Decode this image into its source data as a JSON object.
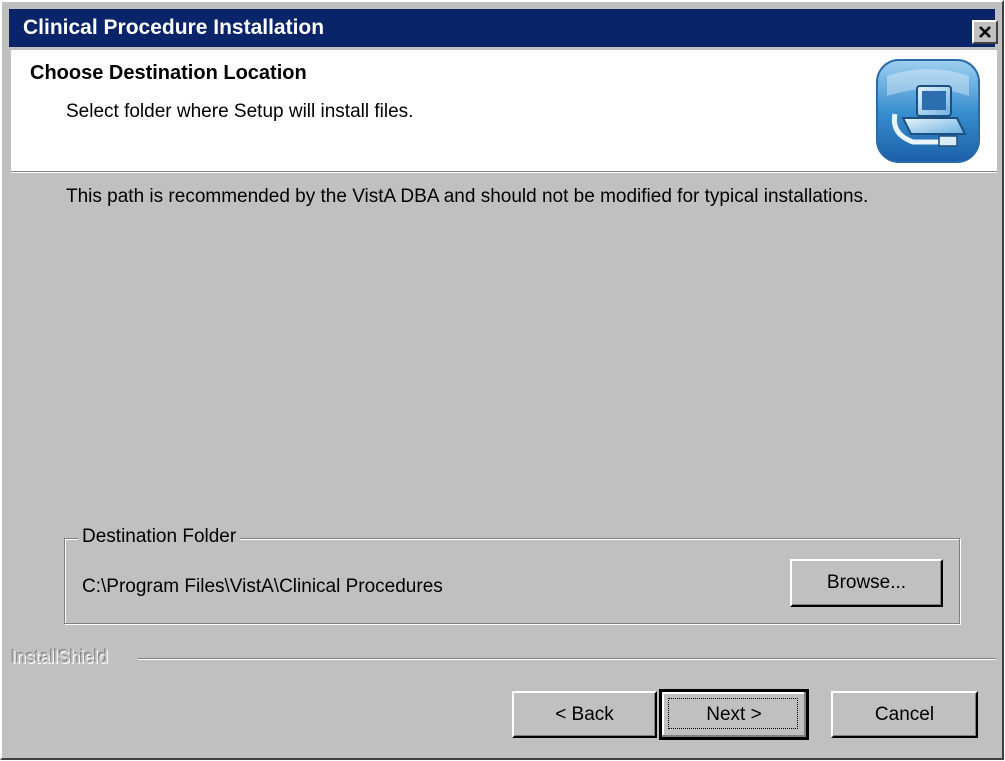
{
  "window": {
    "title": "Clinical Procedure Installation",
    "close_icon": "close-icon"
  },
  "header": {
    "heading": "Choose Destination Location",
    "subheading": "Select folder where Setup will install files.",
    "icon": "computer-setup-icon"
  },
  "body": {
    "message": "This path is recommended by the VistA DBA and should not be modified for typical installations."
  },
  "destination": {
    "group_label": "Destination Folder",
    "path": "C:\\Program Files\\VistA\\Clinical Procedures",
    "browse_label": "Browse..."
  },
  "footer": {
    "brand": "InstallShield",
    "back_label": "< Back",
    "next_label": "Next >",
    "cancel_label": "Cancel"
  },
  "colors": {
    "titlebar": "#0a246a",
    "dialog_face": "#c0c0c0",
    "header_bg": "#ffffff"
  }
}
